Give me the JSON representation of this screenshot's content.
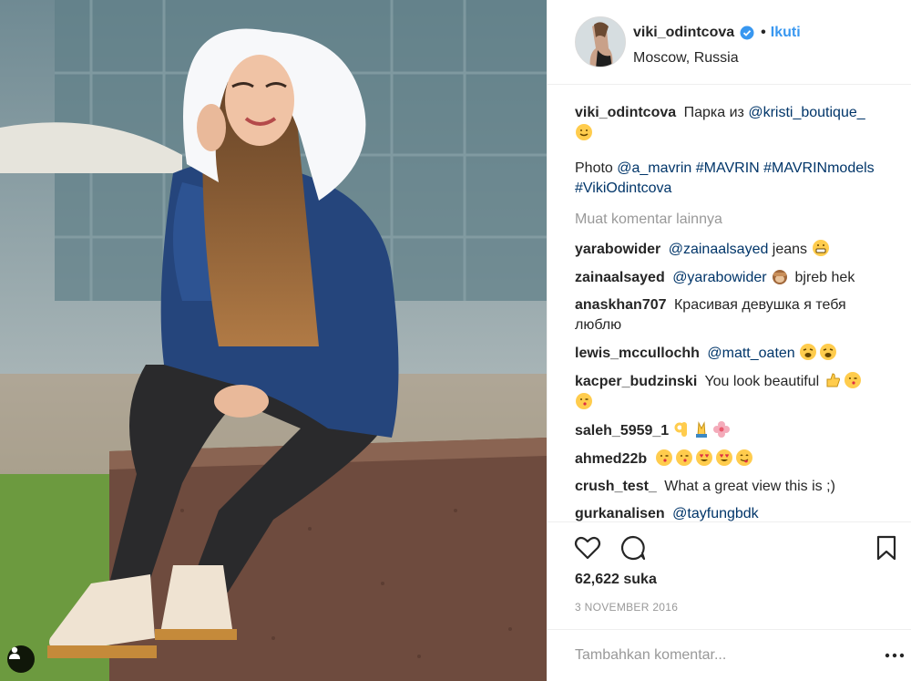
{
  "post": {
    "owner": "viki_odintcova",
    "follow_label": "Ikuti",
    "location": "Moscow, Russia",
    "caption_text": "Парка из",
    "caption_mention": "@kristi_boutique_",
    "caption2_prefix": "Photo",
    "caption2_mention": "@a_mavrin",
    "caption2_tags": "#MAVRIN #MAVRINmodels #VikiOdintcova",
    "more_comments_label": "Muat komentar lainnya",
    "likes": "62,622 suka",
    "date": "3 NOVEMBER 2016",
    "comment_placeholder": "Tambahkan komentar..."
  },
  "comments": [
    {
      "user": "yarabowider",
      "mention": "@zainaalsayed",
      "text": " jeans",
      "emojis": [
        "grin"
      ]
    },
    {
      "user": "zainaalsayed",
      "mention": "@yarabowider",
      "text": " bjreb hek",
      "emojis_before_text": [
        "monkey"
      ]
    },
    {
      "user": "anaskhan707",
      "mention": "",
      "text": "Красивая девушка я тебя люблю",
      "emojis": []
    },
    {
      "user": "lewis_mccullochh",
      "mention": "@matt_oaten",
      "text": "",
      "emojis": [
        "tired",
        "tired"
      ]
    },
    {
      "user": "kacper_budzinski",
      "mention": "",
      "text": "You look beautiful",
      "emojis": [
        "thumbs",
        "wink-kiss",
        "wink-kiss"
      ]
    },
    {
      "user": "saleh_5959_1",
      "mention": "",
      "text": "",
      "emojis": [
        "ok-hand",
        "pray",
        "flower"
      ]
    },
    {
      "user": "ahmed22b",
      "mention": "",
      "text": "",
      "emojis": [
        "wink-kiss",
        "wink-kiss",
        "heart-eyes",
        "heart-eyes",
        "yum"
      ]
    },
    {
      "user": "crush_test_",
      "mention": "",
      "text": "What a great view this is ;)",
      "emojis": []
    },
    {
      "user": "gurkanalisen",
      "mention": "@tayfungbdk",
      "text": "",
      "emojis": []
    }
  ],
  "colors": {
    "link": "#003569",
    "follow": "#3897f0",
    "muted": "#999999",
    "border": "#efefef"
  },
  "icons": [
    "verified-badge-icon",
    "heart-icon",
    "comment-icon",
    "bookmark-icon",
    "more-options-icon",
    "user-tag-icon"
  ]
}
